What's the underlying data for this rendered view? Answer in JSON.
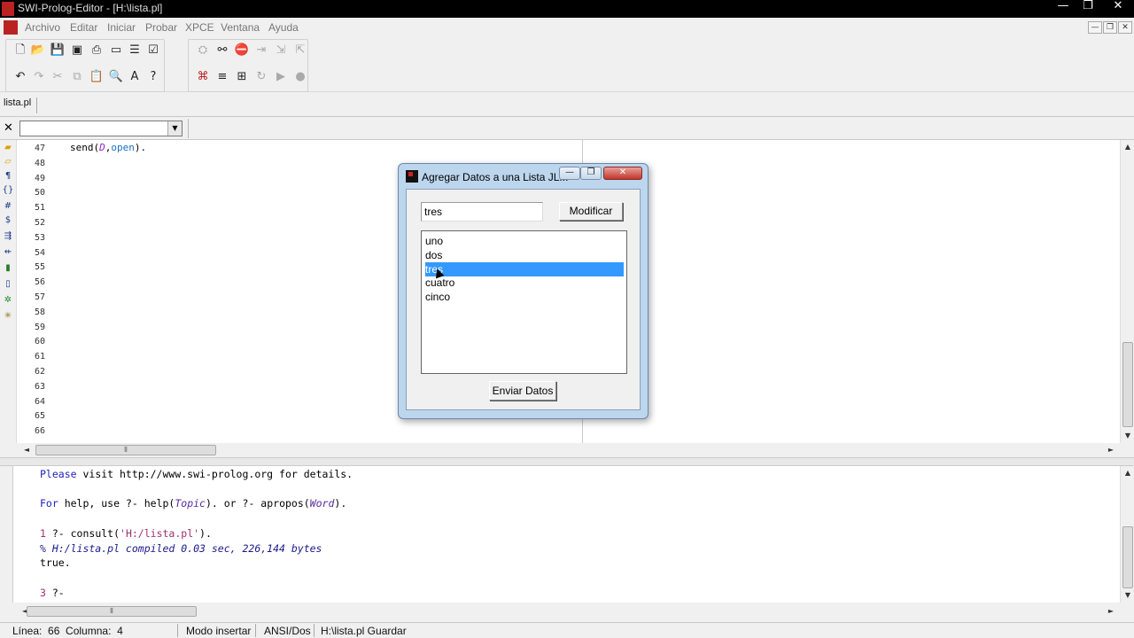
{
  "app": {
    "title": "SWI-Prolog-Editor - [H:\\lista.pl]",
    "window_buttons": [
      "—",
      "❐",
      "✕"
    ]
  },
  "menu": {
    "items": [
      "Archivo",
      "Editar",
      "Iniciar",
      "Probar",
      "XPCE",
      "Ventana",
      "Ayuda"
    ],
    "mdi_buttons": [
      "—",
      "❐",
      "✕"
    ]
  },
  "tabs": [
    {
      "label": "lista.pl"
    }
  ],
  "findbar": {
    "close": "✕",
    "combo_value": ""
  },
  "editor": {
    "line_numbers": [
      "47",
      "48",
      "49",
      "50",
      "51",
      "52",
      "53",
      "54",
      "55",
      "56",
      "57",
      "58",
      "59",
      "60",
      "61",
      "62",
      "63",
      "64",
      "65",
      "66"
    ],
    "code_line_47": {
      "pred": "send(",
      "var": "D",
      "sep": ",",
      "atom": "open",
      "end": ")."
    }
  },
  "dialog": {
    "title": "Agregar Datos a una Lista JL...",
    "text_value": "tres",
    "modify_label": "Modificar",
    "list_items": [
      "uno",
      "dos",
      "tres",
      "cuatro",
      "cinco"
    ],
    "selected_index": 2,
    "send_label": "Enviar Datos",
    "buttons": [
      "—",
      "❐",
      "✕"
    ]
  },
  "console": {
    "line1": {
      "a": "Please",
      "b": " visit http://www.swi-prolog.org for details."
    },
    "line2": {
      "a": "For",
      "b": " help, use ?- ",
      "c": "help",
      "d": "(",
      "e": "Topic",
      "f": "). or ?- ",
      "g": "apropos",
      "h": "(",
      "i": "Word",
      "j": ")."
    },
    "line3": {
      "num": "1",
      "b": " ?- consult(",
      "c": "'H:/lista.pl'",
      "d": ")."
    },
    "line4": "% H:/lista.pl compiled 0.03 sec, 226,144 bytes",
    "line5": "true.",
    "line6": {
      "num": "3",
      "b": " ?-"
    }
  },
  "status": {
    "linea": "Línea:  66  Columna:  4",
    "mode": "Modo insertar",
    "encoding": "ANSI/Dos",
    "file": "H:\\lista.pl Guardar"
  }
}
